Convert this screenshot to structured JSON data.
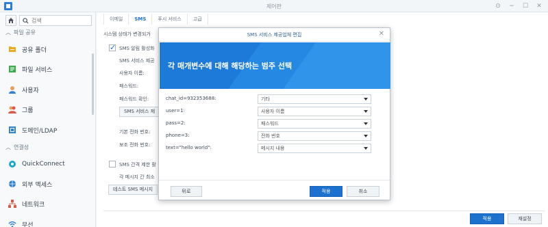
{
  "window": {
    "title": "제어판"
  },
  "search": {
    "placeholder": "검색"
  },
  "sidebar": {
    "sections": [
      {
        "label": "파일 공유"
      },
      {
        "label": "연결성"
      }
    ],
    "items": [
      {
        "label": "공유 폴더"
      },
      {
        "label": "파일 서비스"
      },
      {
        "label": "사용자"
      },
      {
        "label": "그룹"
      },
      {
        "label": "도메인/LDAP"
      },
      {
        "label": "QuickConnect"
      },
      {
        "label": "외부 액세스"
      },
      {
        "label": "네트워크"
      },
      {
        "label": "무선"
      }
    ]
  },
  "tabs": [
    {
      "label": "이메일"
    },
    {
      "label": "SMS"
    },
    {
      "label": "푸시 서비스"
    },
    {
      "label": "고급"
    }
  ],
  "background": {
    "status_text": "시스템 상태가 변경되거",
    "enable_sms": "SMS 알림 활성화",
    "provider": "SMS 서비스 제공",
    "username": "사용자 이름:",
    "password": "패스워드:",
    "password_confirm": "패스워드 확인:",
    "add_provider_btn": "SMS 서비스 제",
    "primary_phone": "기본 전화 번호:",
    "secondary_phone": "보조 전화 번호:",
    "interval_check": "SMS 간격 제한 활",
    "interval_text": "각 메시지 간 최소",
    "test_sms_btn": "테스트 SMS 메시지"
  },
  "main_footer": {
    "apply": "적용",
    "reset": "재설정"
  },
  "dialog": {
    "title": "SMS 서비스 제공업체 편집",
    "heading": "각 매개변수에 대해 해당하는 범주 선택",
    "params": [
      {
        "label": "chat_id=932353688:",
        "value": "기타"
      },
      {
        "label": "user=1:",
        "value": "사용자 이름"
      },
      {
        "label": "pass=2:",
        "value": "패스워드"
      },
      {
        "label": "phone=3:",
        "value": "전화 번호"
      },
      {
        "label": "text=\"hello world\":",
        "value": "메시지 내용"
      }
    ],
    "back": "뒤로",
    "apply": "적용",
    "cancel": "취소"
  },
  "colors": {
    "accent": "#1d72d0",
    "banner": "#1e7ad8"
  }
}
